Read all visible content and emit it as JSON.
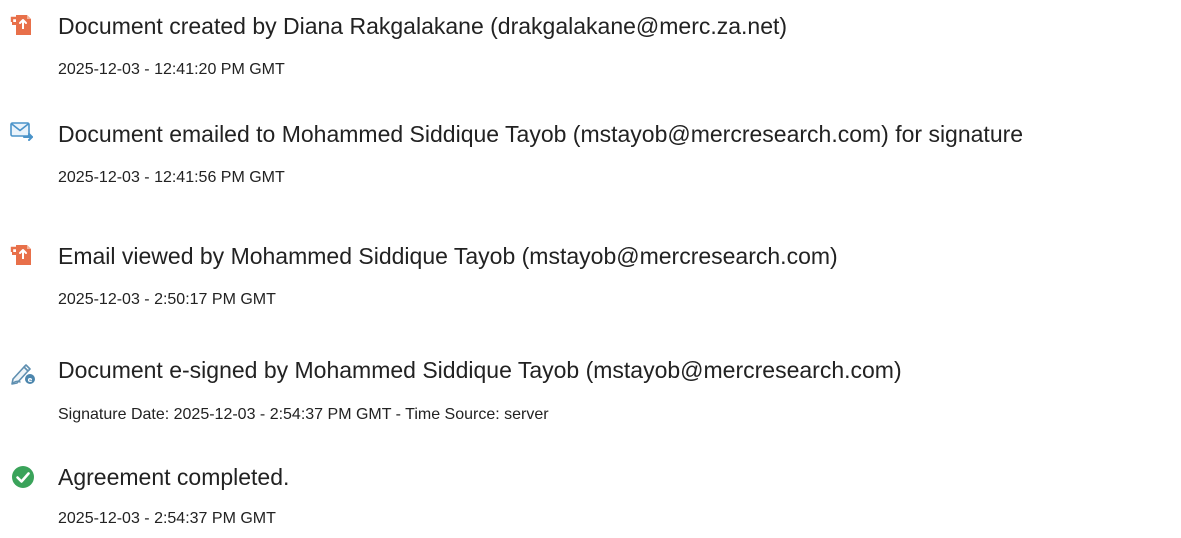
{
  "colors": {
    "document_icon": "#e8704a",
    "email_icon": "#4a93c9",
    "sign_icon": "#5f8fb0",
    "complete_icon": "#3aa35a",
    "text": "#222222"
  },
  "events": [
    {
      "icon": "document-icon",
      "title": "Document created by Diana Rakgalakane (drakgalakane@merc.za.net)",
      "timestamp": "2025-12-03 - 12:41:20 PM GMT"
    },
    {
      "icon": "email-sent-icon",
      "title": "Document emailed to Mohammed Siddique Tayob (mstayob@mercresearch.com) for signature",
      "timestamp": "2025-12-03 - 12:41:56 PM GMT"
    },
    {
      "icon": "document-icon",
      "title": "Email viewed by Mohammed Siddique Tayob (mstayob@mercresearch.com)",
      "timestamp": "2025-12-03 - 2:50:17 PM GMT"
    },
    {
      "icon": "esign-pen-icon",
      "title": "Document e-signed by Mohammed Siddique Tayob (mstayob@mercresearch.com)",
      "timestamp": "Signature Date: 2025-12-03 - 2:54:37 PM GMT - Time Source: server"
    },
    {
      "icon": "checkmark-circle-icon",
      "title": "Agreement completed.",
      "timestamp": "2025-12-03 - 2:54:37 PM GMT"
    }
  ]
}
